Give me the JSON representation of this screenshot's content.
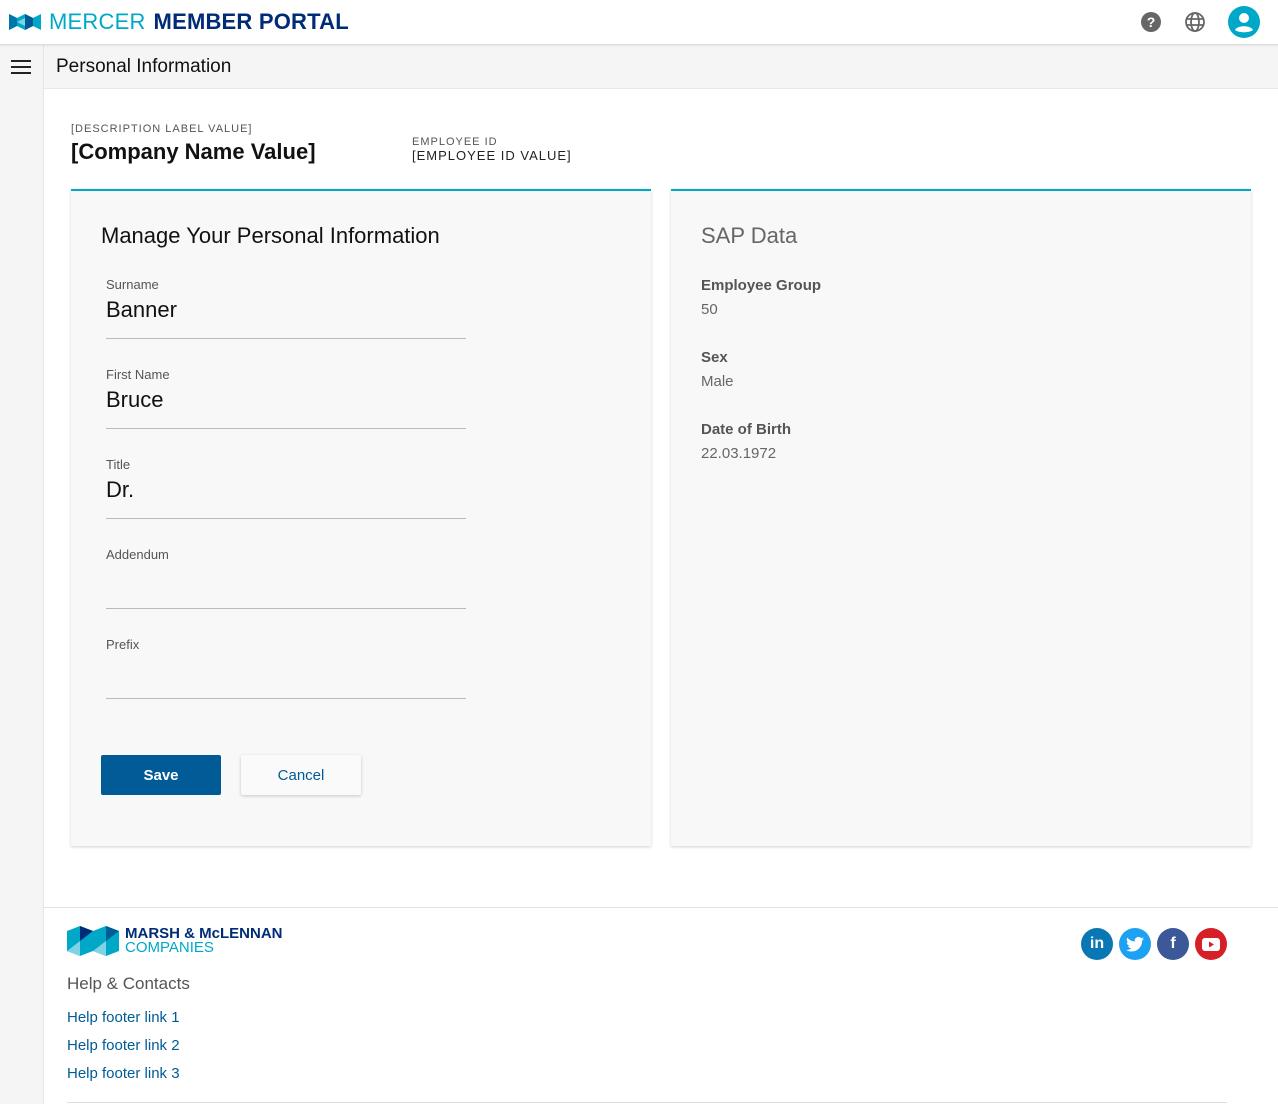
{
  "header": {
    "brand_light": "MERCER",
    "brand_bold": "MEMBER PORTAL",
    "icons": [
      "help-icon",
      "globe-icon",
      "user-avatar-icon"
    ],
    "accent": "#00a8c8",
    "brand_color": "#002c77"
  },
  "subheader": {
    "title": "Personal Information"
  },
  "company": {
    "description_label": "[DESCRIPTION LABEL VALUE]",
    "name": "[Company Name Value]",
    "employee_id_label": "EMPLOYEE ID",
    "employee_id_value": "[EMPLOYEE ID VALUE]"
  },
  "form": {
    "title": "Manage Your Personal Information",
    "fields": [
      {
        "label": "Surname",
        "value": "Banner"
      },
      {
        "label": "First Name",
        "value": "Bruce"
      },
      {
        "label": "Title",
        "value": "Dr."
      },
      {
        "label": "Addendum",
        "value": ""
      },
      {
        "label": "Prefix",
        "value": ""
      }
    ],
    "save_label": "Save",
    "cancel_label": "Cancel",
    "primary_color": "#005b96"
  },
  "sap": {
    "title": "SAP Data",
    "items": [
      {
        "label": "Employee Group",
        "value": "50"
      },
      {
        "label": "Sex",
        "value": "Male"
      },
      {
        "label": "Date of Birth",
        "value": "22.03.1972"
      }
    ]
  },
  "footer": {
    "logo_line1": "MARSH & McLENNAN",
    "logo_line2": "COMPANIES",
    "help_title": "Help & Contacts",
    "links": [
      "Help footer link 1",
      "Help footer link 2",
      "Help footer link 3"
    ],
    "social": [
      "linkedin-icon",
      "twitter-icon",
      "facebook-icon",
      "youtube-icon"
    ]
  }
}
